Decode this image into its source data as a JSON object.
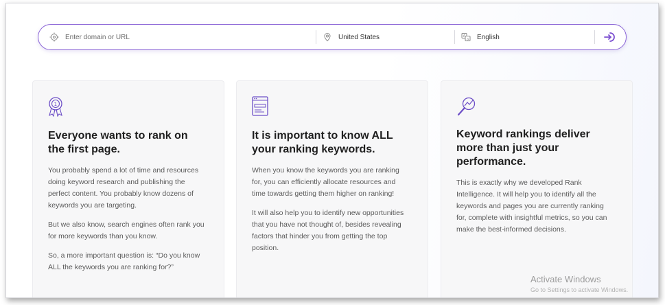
{
  "search": {
    "domain_placeholder": "Enter domain or URL",
    "country": "United States",
    "language": "English"
  },
  "cards": [
    {
      "title": "Everyone wants to rank on the first page.",
      "paragraphs": [
        "You probably spend a lot of time and resources doing keyword research and publishing the perfect content. You probably know dozens of keywords you are targeting.",
        "But we also know, search engines often rank you for more keywords than you know.",
        "So, a more important question is: “Do you know ALL the keywords you are ranking for?”"
      ]
    },
    {
      "title": "It is important to know ALL your ranking keywords.",
      "paragraphs": [
        "When you know the keywords you are ranking for, you can efficiently allocate resources and time towards getting them higher on ranking!",
        "It will also help you to identify new opportunities that you have not thought of, besides revealing factors that hinder you from getting the top position."
      ]
    },
    {
      "title": "Keyword rankings deliver more than just your performance.",
      "paragraphs": [
        "This is exactly why we developed Rank Intelligence. It will help you to identify all the keywords and pages you are currently ranking for, complete with insightful metrics, so you can make the best-informed decisions."
      ]
    }
  ],
  "watermark": {
    "title": "Activate Windows",
    "subtitle": "Go to Settings to activate Windows."
  },
  "colors": {
    "accent": "#7b4fd0",
    "border": "#8a64d6"
  }
}
